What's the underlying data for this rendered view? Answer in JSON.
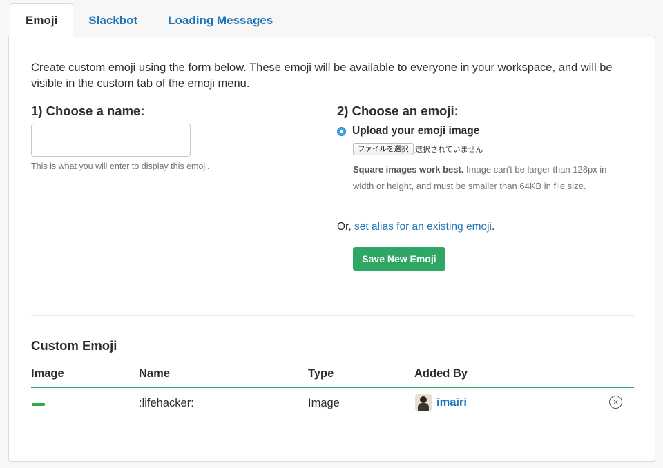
{
  "tabs": [
    {
      "label": "Emoji",
      "active": true
    },
    {
      "label": "Slackbot",
      "active": false
    },
    {
      "label": "Loading Messages",
      "active": false
    }
  ],
  "intro": "Create custom emoji using the form below. These emoji will be available to everyone in your workspace, and will be visible in the custom tab of the emoji menu.",
  "name_step": {
    "heading": "1) Choose a name:",
    "input_value": "",
    "hint": "This is what you will enter to display this emoji."
  },
  "emoji_step": {
    "heading": "2) Choose an emoji:",
    "upload_label": "Upload your emoji image",
    "file_button": "ファイルを選択",
    "file_status": "選択されていません",
    "help_bold": "Square images work best.",
    "help_text": " Image can't be larger than 128px in width or height, and must be smaller than 64KB in file size.",
    "alias_prefix": "Or, ",
    "alias_link": "set alias for an existing emoji",
    "alias_suffix": ".",
    "save_button": "Save New Emoji"
  },
  "custom_emoji": {
    "title": "Custom Emoji",
    "columns": [
      "Image",
      "Name",
      "Type",
      "Added By"
    ],
    "rows": [
      {
        "name": ":lifehacker:",
        "type": "Image",
        "added_by": "imairi"
      }
    ]
  },
  "colors": {
    "accent_green": "#2ea664",
    "link_blue": "#1f75b8",
    "radio_blue": "#3aa3e3"
  },
  "icons": {
    "radio": "radio-selected-icon",
    "remove": "circle-x-icon"
  }
}
